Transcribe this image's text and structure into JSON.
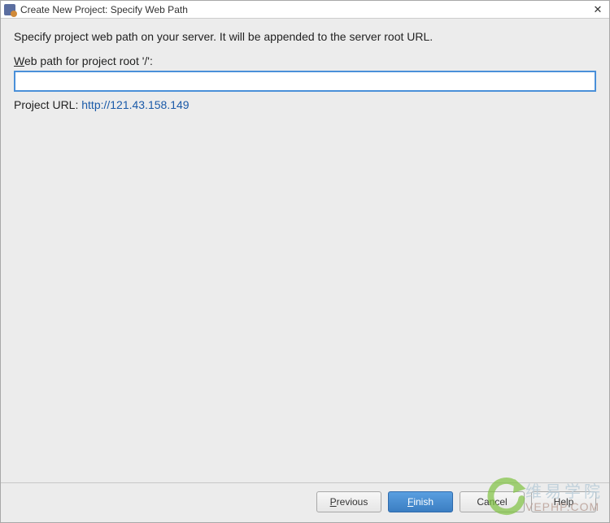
{
  "titlebar": {
    "title": "Create New Project: Specify Web Path",
    "close_label": "✕"
  },
  "content": {
    "instruction": "Specify project web path on your server. It will be appended to the server root URL.",
    "web_path_label_pre": "W",
    "web_path_label_post": "eb path for project root '/':",
    "web_path_value": "",
    "project_url_label": "Project URL: ",
    "project_url_value": "http://121.43.158.149"
  },
  "buttons": {
    "previous_pre": "P",
    "previous_post": "revious",
    "finish_pre": "F",
    "finish_post": "inish",
    "cancel": "Cancel",
    "help": "Help"
  },
  "watermark": {
    "cn": "维易学院",
    "en": "VEPHP.COM"
  }
}
